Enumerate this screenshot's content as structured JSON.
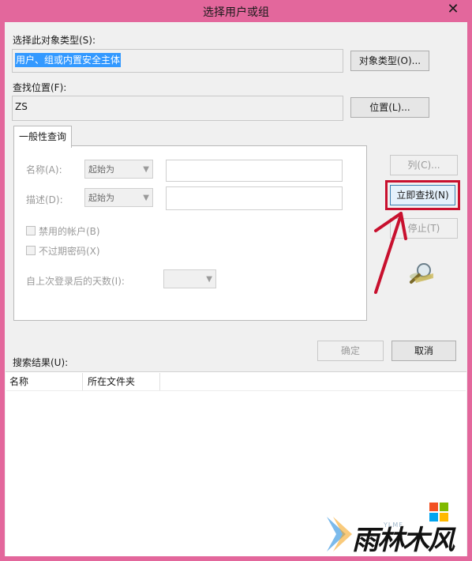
{
  "window": {
    "title": "选择用户或组",
    "close_glyph": "✕"
  },
  "object_type": {
    "label": "选择此对象类型(S):",
    "value": "用户、组或内置安全主体",
    "button": "对象类型(O)..."
  },
  "location": {
    "label": "查找位置(F):",
    "value": "ZS",
    "button": "位置(L)..."
  },
  "tabs": [
    "一般性查询"
  ],
  "query": {
    "name_label": "名称(A):",
    "name_mode": "起始为",
    "desc_label": "描述(D):",
    "desc_mode": "起始为",
    "disabled_accounts": "禁用的帐户(B)",
    "non_expiring": "不过期密码(X)",
    "days_label": "自上次登录后的天数(I):"
  },
  "side_buttons": {
    "columns": "列(C)...",
    "find_now": "立即查找(N)",
    "stop": "停止(T)"
  },
  "dialog_buttons": {
    "ok": "确定",
    "cancel": "取消"
  },
  "results": {
    "label": "搜索结果(U):",
    "columns": [
      "名称",
      "所在文件夹"
    ]
  },
  "watermark": {
    "text": "雨林木风",
    "sub": "YLMF"
  },
  "colors": {
    "frame": "#e3679c",
    "highlight": "#c8102e",
    "selection": "#3399ff"
  },
  "icons": [
    "close-icon",
    "chevron-down-icon",
    "search-binoculars-icon",
    "arrow-annotation"
  ]
}
